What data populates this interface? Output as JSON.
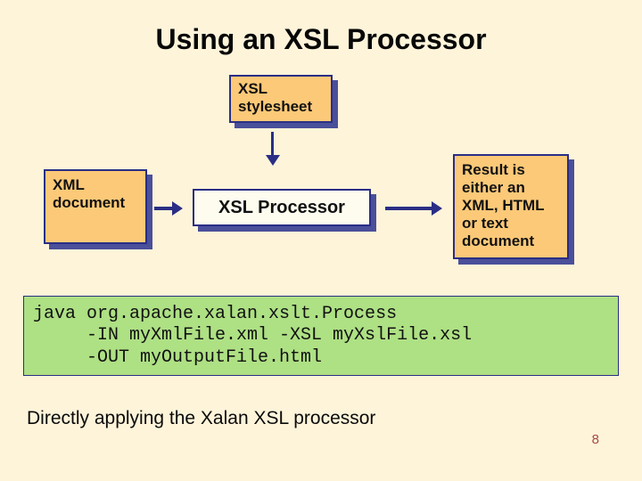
{
  "slide": {
    "title": "Using an XSL Processor",
    "page_number": "8",
    "caption": "Directly applying the Xalan XSL processor"
  },
  "boxes": {
    "stylesheet": "XSL\nstylesheet",
    "xml": "XML\ndocument",
    "processor": "XSL Processor",
    "result": "Result is\neither an\nXML, HTML\nor text\ndocument"
  },
  "command": "java org.apache.xalan.xslt.Process\n     -IN myXmlFile.xml -XSL myXslFile.xsl\n     -OUT myOutputFile.html",
  "colors": {
    "background": "#fef4da",
    "box_fill": "#fcc978",
    "proc_fill": "#fefcee",
    "cmd_fill": "#aee084",
    "border": "#2a2e85"
  }
}
